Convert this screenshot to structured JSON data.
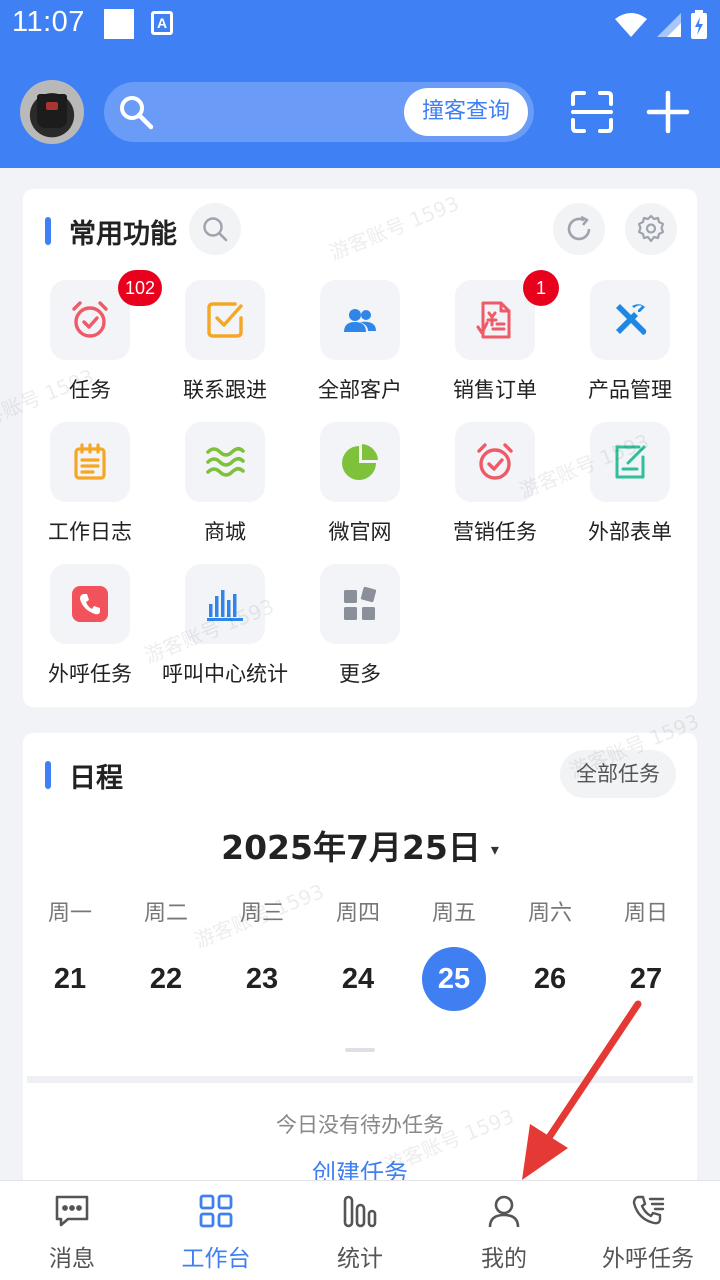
{
  "status_bar": {
    "time": "11:07",
    "a_label": "A"
  },
  "header": {
    "search_button_label": "撞客查询",
    "icons": [
      "scan-icon",
      "plus-icon",
      "search-icon"
    ]
  },
  "common_functions": {
    "title": "常用功能",
    "items": [
      {
        "label": "任务",
        "icon": "alarm-clock-icon",
        "badge": "102"
      },
      {
        "label": "联系跟进",
        "icon": "checkbox-icon",
        "badge": ""
      },
      {
        "label": "全部客户",
        "icon": "users-icon",
        "badge": ""
      },
      {
        "label": "销售订单",
        "icon": "order-icon",
        "badge": "1"
      },
      {
        "label": "产品管理",
        "icon": "tools-icon",
        "badge": ""
      },
      {
        "label": "工作日志",
        "icon": "notepad-icon",
        "badge": ""
      },
      {
        "label": "商城",
        "icon": "waves-icon",
        "badge": ""
      },
      {
        "label": "微官网",
        "icon": "pie-icon",
        "badge": ""
      },
      {
        "label": "营销任务",
        "icon": "alarm-clock-icon",
        "badge": ""
      },
      {
        "label": "外部表单",
        "icon": "form-edit-icon",
        "badge": ""
      },
      {
        "label": "外呼任务",
        "icon": "phone-icon",
        "badge": ""
      },
      {
        "label": "呼叫中心统计",
        "icon": "bar-chart-icon",
        "badge": ""
      },
      {
        "label": "更多",
        "icon": "more-grid-icon",
        "badge": ""
      }
    ]
  },
  "schedule": {
    "title": "日程",
    "all_tasks_label": "全部任务",
    "date_title": "2025年7月25日",
    "caret": "▾",
    "weekdays": [
      {
        "name": "周一",
        "day": "21",
        "selected": false
      },
      {
        "name": "周二",
        "day": "22",
        "selected": false
      },
      {
        "name": "周三",
        "day": "23",
        "selected": false
      },
      {
        "name": "周四",
        "day": "24",
        "selected": false
      },
      {
        "name": "周五",
        "day": "25",
        "selected": true
      },
      {
        "name": "周六",
        "day": "26",
        "selected": false
      },
      {
        "name": "周日",
        "day": "27",
        "selected": false
      }
    ],
    "empty_text": "今日没有待办任务",
    "create_label": "创建任务"
  },
  "watermark_text": "游客账号 1593",
  "tab_bar": [
    {
      "label": "消息",
      "icon": "message-icon",
      "active": false
    },
    {
      "label": "工作台",
      "icon": "workbench-icon",
      "active": true
    },
    {
      "label": "统计",
      "icon": "stats-icon",
      "active": false
    },
    {
      "label": "我的",
      "icon": "profile-icon",
      "active": false
    },
    {
      "label": "外呼任务",
      "icon": "phone-list-icon",
      "active": false
    }
  ],
  "colors": {
    "primary": "#4080f5",
    "badge": "#e8001d",
    "arrow": "#e53935"
  }
}
